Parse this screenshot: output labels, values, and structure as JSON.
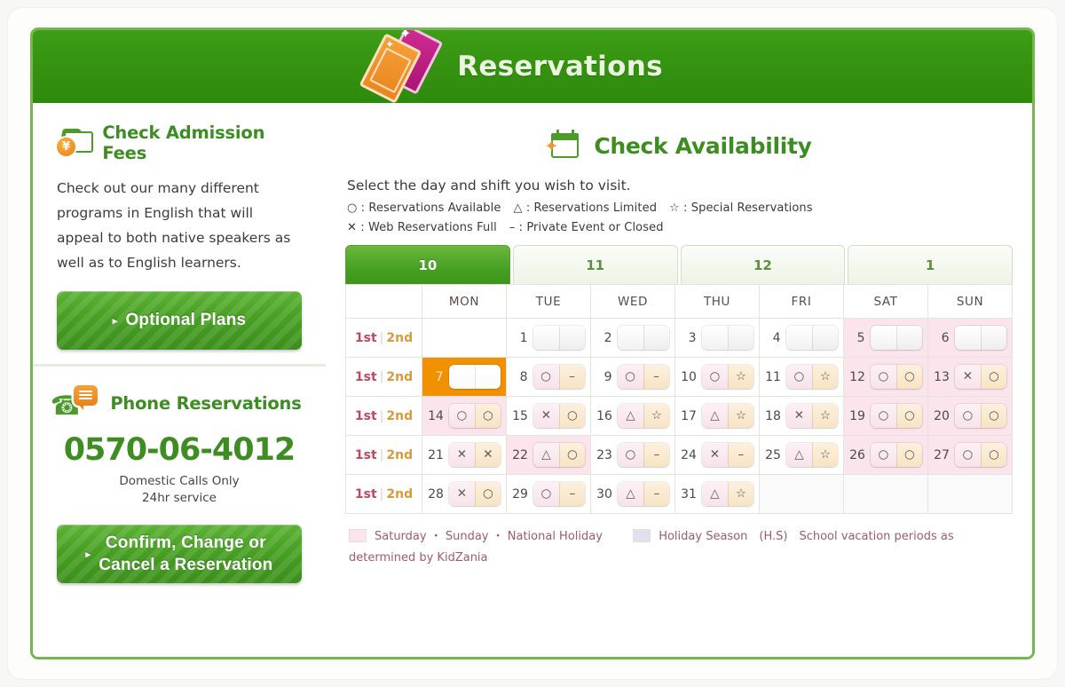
{
  "header": {
    "title": "Reservations",
    "icon": "ticket-icon"
  },
  "sidebar": {
    "fees": {
      "icon": "wallet-coin-icon",
      "title": "Check Admission Fees",
      "body": "Check out our many different programs in English that will appeal to both native speakers as well as to English learners.",
      "button": "Optional Plans",
      "arrow": "▸"
    },
    "phone": {
      "icon": "phone-bubble-icon",
      "title": "Phone Reservations",
      "number": "0570-06-4012",
      "note_line1": "Domestic Calls Only",
      "note_line2": "24hr service",
      "button_line1": "Confirm, Change or",
      "button_line2": "Cancel a Reservation",
      "arrow": "▸"
    }
  },
  "main": {
    "icon": "calendar-star-icon",
    "title": "Check Availability",
    "instruction": "Select the day and shift you wish to visit.",
    "legend_row1": [
      {
        "symbol": "○",
        "text": ": Reservations Available"
      },
      {
        "symbol": "△",
        "text": ": Reservations Limited"
      },
      {
        "symbol": "☆",
        "text": ": Special Reservations"
      }
    ],
    "legend_row2": [
      {
        "symbol": "✕",
        "text": ": Web Reservations Full"
      },
      {
        "symbol": "–",
        "text": ": Private Event or Closed"
      }
    ],
    "month_tabs": [
      {
        "label": "10",
        "active": true
      },
      {
        "label": "11",
        "active": false
      },
      {
        "label": "12",
        "active": false
      },
      {
        "label": "1",
        "active": false
      }
    ],
    "shift_label": {
      "first": "1st",
      "separator": "|",
      "second": "2nd"
    },
    "weekday_headers": [
      "MON",
      "TUE",
      "WED",
      "THU",
      "FRI",
      "SAT",
      "SUN"
    ],
    "weeks": [
      [
        {
          "day": null
        },
        {
          "day": "1",
          "first": "",
          "second": "",
          "style": "empty"
        },
        {
          "day": "2",
          "first": "",
          "second": "",
          "style": "empty"
        },
        {
          "day": "3",
          "first": "",
          "second": "",
          "style": "empty"
        },
        {
          "day": "4",
          "first": "",
          "second": "",
          "style": "empty"
        },
        {
          "day": "5",
          "first": "",
          "second": "",
          "style": "empty",
          "bg": "weekend"
        },
        {
          "day": "6",
          "first": "",
          "second": "",
          "style": "empty",
          "bg": "weekend"
        }
      ],
      [
        {
          "day": "7",
          "first": "",
          "second": "",
          "style": "empty",
          "selected": true
        },
        {
          "day": "8",
          "first": "○",
          "second": "–"
        },
        {
          "day": "9",
          "first": "○",
          "second": "–"
        },
        {
          "day": "10",
          "first": "○",
          "second": "☆"
        },
        {
          "day": "11",
          "first": "○",
          "second": "☆"
        },
        {
          "day": "12",
          "first": "○",
          "second": "○",
          "bg": "weekend"
        },
        {
          "day": "13",
          "first": "✕",
          "second": "○",
          "bg": "weekend"
        }
      ],
      [
        {
          "day": "14",
          "first": "○",
          "second": "○",
          "bg": "holiday"
        },
        {
          "day": "15",
          "first": "✕",
          "second": "○"
        },
        {
          "day": "16",
          "first": "△",
          "second": "☆"
        },
        {
          "day": "17",
          "first": "△",
          "second": "☆"
        },
        {
          "day": "18",
          "first": "✕",
          "second": "☆"
        },
        {
          "day": "19",
          "first": "○",
          "second": "○",
          "bg": "weekend"
        },
        {
          "day": "20",
          "first": "○",
          "second": "○",
          "bg": "weekend"
        }
      ],
      [
        {
          "day": "21",
          "first": "✕",
          "second": "✕"
        },
        {
          "day": "22",
          "first": "△",
          "second": "○",
          "bg": "holiday"
        },
        {
          "day": "23",
          "first": "○",
          "second": "–"
        },
        {
          "day": "24",
          "first": "✕",
          "second": "–"
        },
        {
          "day": "25",
          "first": "△",
          "second": "☆"
        },
        {
          "day": "26",
          "first": "○",
          "second": "○",
          "bg": "weekend"
        },
        {
          "day": "27",
          "first": "○",
          "second": "○",
          "bg": "weekend"
        }
      ],
      [
        {
          "day": "28",
          "first": "✕",
          "second": "○"
        },
        {
          "day": "29",
          "first": "○",
          "second": "–"
        },
        {
          "day": "30",
          "first": "△",
          "second": "–"
        },
        {
          "day": "31",
          "first": "△",
          "second": "☆"
        },
        {
          "day": null,
          "bg": "blank"
        },
        {
          "day": null,
          "bg": "blank"
        },
        {
          "day": null,
          "bg": "blank"
        }
      ]
    ],
    "bottom_legend": {
      "pink_label": "Saturday ・ Sunday ・ National Holiday",
      "purple_label": "Holiday Season　(H.S)　School vacation periods as determined by KidZania"
    }
  },
  "colors": {
    "brand_green": "#3e8d23",
    "header_green": "#349110",
    "accent_orange": "#f29100",
    "weekend_pink": "#fbe4ec",
    "holiday_purple": "#e2e0ec"
  }
}
